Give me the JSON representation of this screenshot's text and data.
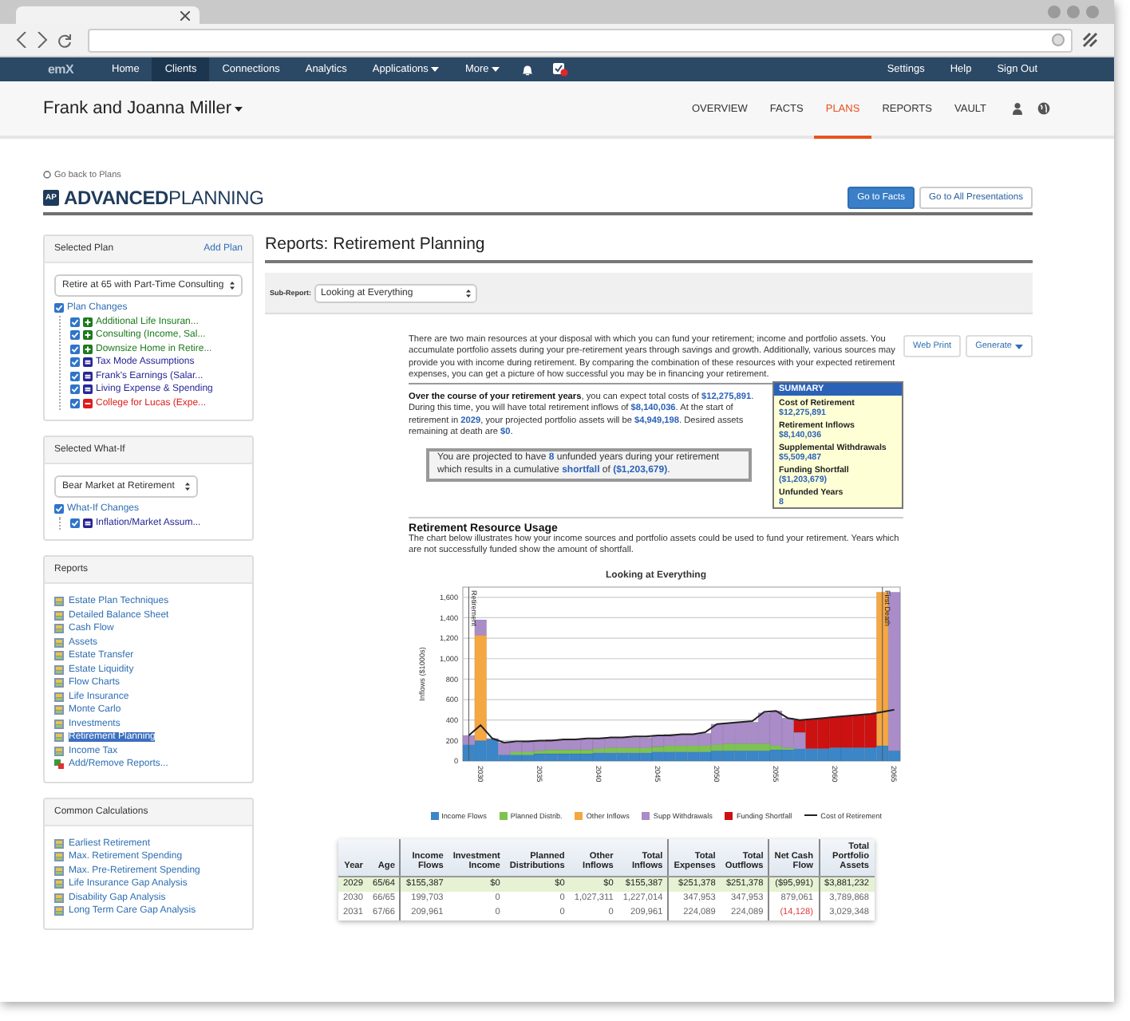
{
  "nav": {
    "logo": "emX",
    "items": [
      {
        "label": "Home",
        "selected": false,
        "dropdown": false
      },
      {
        "label": "Clients",
        "selected": true,
        "dropdown": false
      },
      {
        "label": "Connections",
        "selected": false,
        "dropdown": false
      },
      {
        "label": "Analytics",
        "selected": false,
        "dropdown": false
      },
      {
        "label": "Applications",
        "selected": false,
        "dropdown": true
      },
      {
        "label": "More",
        "selected": false,
        "dropdown": true
      }
    ],
    "right_items": [
      "Settings",
      "Help",
      "Sign Out"
    ]
  },
  "client": {
    "name": "Frank and Joanna Miller",
    "tabs": [
      {
        "label": "OVERVIEW",
        "selected": false
      },
      {
        "label": "FACTS",
        "selected": false
      },
      {
        "label": "PLANS",
        "selected": true
      },
      {
        "label": "REPORTS",
        "selected": false
      },
      {
        "label": "VAULT",
        "selected": false
      }
    ]
  },
  "back_link": "Go back to Plans",
  "brand": {
    "badge": "AP",
    "strong": "ADVANCED",
    "light": "PLANNING"
  },
  "header_buttons": [
    {
      "label": "Go to Facts",
      "kind": "primary"
    },
    {
      "label": "Go to All Presentations",
      "kind": "default"
    }
  ],
  "selected_plan": {
    "title": "Selected Plan",
    "action": "Add Plan",
    "select": "Retire at 65 with Part-Time Consulting",
    "changes": {
      "label": "Plan Changes",
      "checked": true,
      "children": [
        {
          "label": "Additional Life Insuran...",
          "checked": true,
          "kind": "add"
        },
        {
          "label": "Consulting (Income, Sal...",
          "checked": true,
          "kind": "add"
        },
        {
          "label": "Downsize Home in Retire...",
          "checked": true,
          "kind": "add"
        },
        {
          "label": "Tax Mode Assumptions",
          "checked": true,
          "kind": "modify"
        },
        {
          "label": "Frank's Earnings (Salar...",
          "checked": true,
          "kind": "modify"
        },
        {
          "label": "Living Expense & Spending",
          "checked": true,
          "kind": "modify"
        },
        {
          "label": "College for Lucas (Expe...",
          "checked": true,
          "kind": "remove"
        }
      ]
    }
  },
  "selected_what_if": {
    "title": "Selected What-If",
    "select": "Bear Market at Retirement",
    "changes": {
      "label": "What-If Changes",
      "checked": true,
      "children": [
        {
          "label": "Inflation/Market Assum...",
          "checked": true,
          "kind": "modify"
        }
      ]
    }
  },
  "reports": {
    "title": "Reports",
    "items": [
      {
        "label": "Estate Plan Techniques",
        "selected": false
      },
      {
        "label": "Detailed Balance Sheet",
        "selected": false
      },
      {
        "label": "Cash Flow",
        "selected": false
      },
      {
        "label": "Assets",
        "selected": false
      },
      {
        "label": "Estate Transfer",
        "selected": false
      },
      {
        "label": "Estate Liquidity",
        "selected": false
      },
      {
        "label": "Flow Charts",
        "selected": false
      },
      {
        "label": "Life Insurance",
        "selected": false
      },
      {
        "label": "Monte Carlo",
        "selected": false
      },
      {
        "label": "Investments",
        "selected": false
      },
      {
        "label": "Retirement Planning",
        "selected": true
      },
      {
        "label": "Income Tax",
        "selected": false
      }
    ],
    "add_link": "Add/Remove Reports..."
  },
  "common_calculations": {
    "title": "Common Calculations",
    "items": [
      "Earliest Retirement",
      "Max. Retirement Spending",
      "Max. Pre-Retirement Spending",
      "Life Insurance Gap Analysis",
      "Disability Gap Analysis",
      "Long Term Care Gap Analysis"
    ]
  },
  "report": {
    "title": "Reports: Retirement Planning",
    "sub_report": {
      "label": "Sub-Report:",
      "value": "Looking at Everything"
    },
    "buttons": [
      {
        "label": "Web Print",
        "dropdown": false
      },
      {
        "label": "Generate",
        "dropdown": true
      }
    ],
    "intro": "There are two main resources at your disposal with which you can fund your retirement; income and portfolio assets. You accumulate portfolio assets during your pre-retirement years through savings and growth. Additionally, various sources may provide you with income during retirement. By comparing the combination of these resources with your expected retirement expenses, you can get a picture of how successful you may be in financing your retirement.",
    "summary": [
      {
        "text": "Over the course of your retirement years",
        "kind": "lead"
      },
      {
        "text": ", you can expect total costs of ",
        "kind": "plain"
      },
      {
        "text": "$12,275,891",
        "kind": "value"
      },
      {
        "text": ". During this time, you will have total retirement inflows of ",
        "kind": "plain"
      },
      {
        "text": "$8,140,036",
        "kind": "value"
      },
      {
        "text": ". At the start of retirement in ",
        "kind": "plain"
      },
      {
        "text": "2029",
        "kind": "value"
      },
      {
        "text": ", your projected portfolio assets will be ",
        "kind": "plain"
      },
      {
        "text": "$4,949,198",
        "kind": "value"
      },
      {
        "text": ". Desired assets remaining at death are ",
        "kind": "plain"
      },
      {
        "text": "$0",
        "kind": "value"
      },
      {
        "text": ".",
        "kind": "plain"
      }
    ],
    "callout": [
      {
        "text": "You are projected to have ",
        "kind": "plain"
      },
      {
        "text": "8",
        "kind": "value"
      },
      {
        "text": " unfunded years during your retirement which results in a cumulative ",
        "kind": "plain"
      },
      {
        "text": "shortfall",
        "kind": "value"
      },
      {
        "text": " of ",
        "kind": "plain"
      },
      {
        "text": "($1,203,679)",
        "kind": "value"
      },
      {
        "text": ".",
        "kind": "plain"
      }
    ],
    "summary_box": {
      "title": "SUMMARY",
      "items": [
        {
          "label": "Cost of Retirement",
          "value": "$12,275,891"
        },
        {
          "label": "Retirement Inflows",
          "value": "$8,140,036"
        },
        {
          "label": "Supplemental Withdrawals",
          "value": "$5,509,487"
        },
        {
          "label": "Funding Shortfall",
          "value": "($1,203,679)"
        },
        {
          "label": "Unfunded Years",
          "value": "8"
        }
      ]
    },
    "usage": {
      "title": "Retirement Resource Usage",
      "text": "The chart below illustrates how your income sources and portfolio assets could be used to fund your retirement. Years which are not successfully funded show the amount of shortfall."
    },
    "chart": {
      "chart_data": {
        "type": "bar",
        "stacked": true,
        "title": "Looking at Everything",
        "ylabel": "Inflows ($1000s)",
        "x": [
          2029,
          2030,
          2031,
          2032,
          2033,
          2034,
          2035,
          2036,
          2037,
          2038,
          2039,
          2040,
          2041,
          2042,
          2043,
          2044,
          2045,
          2046,
          2047,
          2048,
          2049,
          2050,
          2051,
          2052,
          2053,
          2054,
          2055,
          2056,
          2057,
          2058,
          2059,
          2060,
          2061,
          2062,
          2063,
          2064,
          2065
        ],
        "xlim": [
          2028.5,
          2065.5
        ],
        "ylim": [
          0,
          1700
        ],
        "yticks": [
          0,
          200,
          400,
          600,
          800,
          {
            "value": 1000,
            "label": "1,000"
          },
          {
            "value": 1200,
            "label": "1,200"
          },
          {
            "value": 1400,
            "label": "1,400"
          },
          {
            "value": 1600,
            "label": "1,600"
          }
        ],
        "xticks": [
          2030,
          2035,
          2040,
          2045,
          2050,
          2055,
          2060,
          2065
        ],
        "grid": true,
        "ref_lines": [
          {
            "axis": "x",
            "value": 2029,
            "label": "Retirement"
          },
          {
            "axis": "x",
            "value": 2064,
            "label": "First Death"
          }
        ],
        "series": [
          {
            "name": "Income Flows",
            "color": "#3a86c8",
            "values": [
              160,
              200,
              210,
              60,
              60,
              60,
              70,
              70,
              70,
              70,
              70,
              80,
              80,
              80,
              80,
              80,
              90,
              90,
              90,
              90,
              90,
              100,
              100,
              100,
              100,
              100,
              110,
              110,
              120,
              120,
              120,
              130,
              130,
              130,
              130,
              150,
              100
            ]
          },
          {
            "name": "Planned Distrib.",
            "color": "#7ec352",
            "values": [
              0,
              0,
              0,
              0,
              30,
              30,
              30,
              40,
              40,
              40,
              40,
              40,
              50,
              50,
              50,
              50,
              50,
              60,
              60,
              60,
              60,
              60,
              70,
              70,
              70,
              70,
              40,
              20,
              0,
              0,
              0,
              0,
              0,
              0,
              0,
              0,
              0
            ]
          },
          {
            "name": "Other Inflows",
            "color": "#f5a742",
            "values": [
              0,
              1030,
              0,
              0,
              0,
              0,
              0,
              0,
              0,
              0,
              0,
              0,
              0,
              0,
              0,
              0,
              0,
              0,
              0,
              0,
              0,
              0,
              0,
              0,
              0,
              0,
              0,
              0,
              0,
              0,
              0,
              0,
              0,
              0,
              0,
              1500,
              0
            ]
          },
          {
            "name": "Supp Withdrawals",
            "color": "#a98cc8",
            "values": [
              90,
              150,
              10,
              120,
              90,
              100,
              100,
              100,
              100,
              100,
              100,
              100,
              100,
              100,
              100,
              100,
              110,
              110,
              110,
              110,
              120,
              200,
              200,
              210,
              210,
              300,
              340,
              290,
              160,
              0,
              0,
              0,
              0,
              0,
              0,
              0,
              1550
            ]
          },
          {
            "name": "Funding Shortfall",
            "color": "#cc1111",
            "values": [
              0,
              0,
              0,
              0,
              0,
              0,
              0,
              0,
              0,
              0,
              0,
              0,
              0,
              0,
              0,
              0,
              0,
              0,
              0,
              0,
              0,
              0,
              0,
              0,
              0,
              0,
              0,
              0,
              120,
              290,
              300,
              300,
              310,
              320,
              330,
              0,
              0
            ]
          },
          {
            "name": "Cost of Retirement",
            "color": "#222222",
            "type": "line",
            "values": [
              250,
              350,
              220,
              180,
              190,
              190,
              200,
              200,
              210,
              210,
              220,
              220,
              230,
              230,
              240,
              240,
              250,
              250,
              260,
              260,
              280,
              360,
              370,
              380,
              390,
              480,
              490,
              420,
              400,
              410,
              420,
              430,
              440,
              450,
              460,
              480,
              500
            ]
          }
        ]
      }
    },
    "table": {
      "columns": [
        {
          "label": "Year",
          "divider_after": false
        },
        {
          "label": "Age",
          "divider_after": true
        },
        {
          "label": "Income\nFlows",
          "divider_after": false
        },
        {
          "label": "Investment\nIncome",
          "divider_after": false
        },
        {
          "label": "Planned\nDistributions",
          "divider_after": false
        },
        {
          "label": "Other\nInflows",
          "divider_after": false
        },
        {
          "label": "Total\nInflows",
          "divider_after": true
        },
        {
          "label": "Total\nExpenses",
          "divider_after": false
        },
        {
          "label": "Total\nOutflows",
          "divider_after": true
        },
        {
          "label": "Net Cash\nFlow",
          "divider_after": true
        },
        {
          "label": "Total\nPortfolio\nAssets",
          "divider_after": false
        }
      ],
      "rows": [
        {
          "selected": true,
          "net_negative": true,
          "cells": [
            "2029",
            "65/64",
            "$155,387",
            "$0",
            "$0",
            "$0",
            "$155,387",
            "$251,378",
            "$251,378",
            "($95,991)",
            "$3,881,232"
          ]
        },
        {
          "selected": false,
          "net_negative": false,
          "cells": [
            "2030",
            "66/65",
            "199,703",
            "0",
            "0",
            "1,027,311",
            "1,227,014",
            "347,953",
            "347,953",
            "879,061",
            "3,789,868"
          ]
        },
        {
          "selected": false,
          "net_negative": true,
          "cells": [
            "2031",
            "67/66",
            "209,961",
            "0",
            "0",
            "0",
            "209,961",
            "224,089",
            "224,089",
            "(14,128)",
            "3,029,348"
          ]
        }
      ]
    }
  }
}
